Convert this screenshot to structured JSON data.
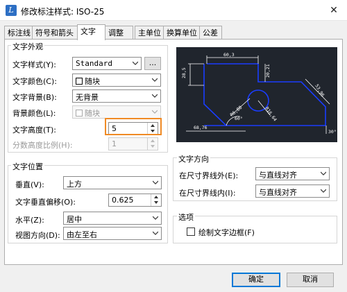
{
  "window": {
    "title": "修改标注样式: ISO-25",
    "icon": "app-logo-icon",
    "close_icon": "close-icon",
    "close_glyph": "✕"
  },
  "tabs": [
    {
      "label": "标注线",
      "active": false
    },
    {
      "label": "符号和箭头",
      "active": false
    },
    {
      "label": "文字",
      "active": true
    },
    {
      "label": "调整",
      "active": false
    },
    {
      "label": "主单位",
      "active": false
    },
    {
      "label": "换算单位",
      "active": false
    },
    {
      "label": "公差",
      "active": false
    }
  ],
  "text_appearance": {
    "title": "文字外观",
    "text_style": {
      "label": "文字样式(Y):",
      "value": "Standard",
      "browse_label": "..."
    },
    "text_color": {
      "label": "文字颜色(C):",
      "value": "随块"
    },
    "text_background": {
      "label": "文字背景(B):",
      "value": "无背景"
    },
    "background_color": {
      "label": "背景颜色(L):",
      "value": "随块",
      "disabled": true
    },
    "text_height": {
      "label": "文字高度(T):",
      "value": "5"
    },
    "fraction_height_scale": {
      "label": "分数高度比例(H):",
      "value": "1",
      "disabled": true
    }
  },
  "preview": {
    "dimensions": [
      "60,3",
      "28,5",
      "20,21",
      "53,96",
      "R16,64",
      "R6,88",
      "60°",
      "68,76",
      "30°"
    ],
    "line_color": "#1a3dff",
    "text_color": "#ffffff",
    "background": "#20252d"
  },
  "text_placement": {
    "title": "文字位置",
    "vertical": {
      "label": "垂直(V):",
      "value": "上方"
    },
    "vertical_offset": {
      "label": "文字垂直偏移(O):",
      "value": "0.625"
    },
    "horizontal": {
      "label": "水平(Z):",
      "value": "居中"
    },
    "view_direction": {
      "label": "视图方向(D):",
      "value": "由左至右"
    }
  },
  "text_alignment": {
    "title": "文字方向",
    "outside": {
      "label": "在尺寸界线外(E):",
      "value": "与直线对齐"
    },
    "inside": {
      "label": "在尺寸界线内(I):",
      "value": "与直线对齐"
    }
  },
  "options": {
    "title": "选项",
    "draw_frame": {
      "label": "绘制文字边框(F)",
      "checked": false
    }
  },
  "buttons": {
    "ok": "确定",
    "cancel": "取消"
  },
  "highlight_color": "#f08a24"
}
